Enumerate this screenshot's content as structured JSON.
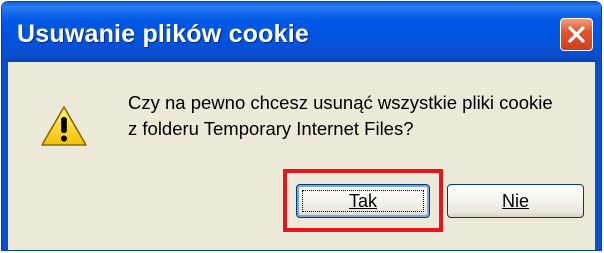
{
  "dialog": {
    "title": "Usuwanie plików cookie",
    "message_line1": "Czy na pewno chcesz usunąć wszystkie pliki cookie",
    "message_line2": "z folderu Temporary Internet Files?",
    "icon": "warning-icon",
    "buttons": {
      "yes_label": "Tak",
      "no_label": "Nie"
    }
  },
  "colors": {
    "titlebar": "#0054e3",
    "close_button": "#e2562e",
    "highlight": "#e8141c",
    "background": "#ece9d8"
  }
}
